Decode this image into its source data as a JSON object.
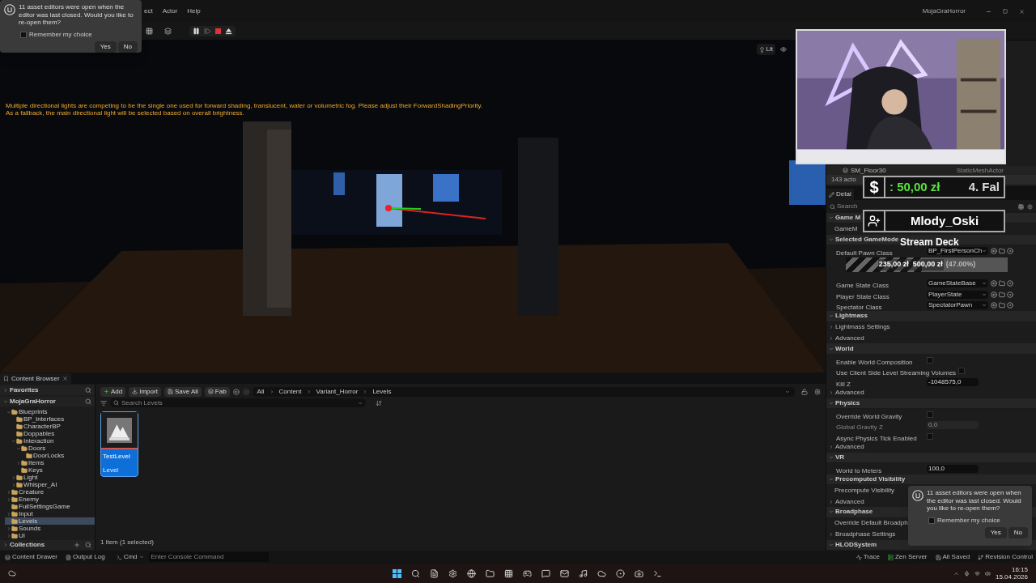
{
  "title_bar": {
    "menu": [
      "ect",
      "Actor",
      "Help"
    ],
    "project": "MojaGraHorror"
  },
  "viewport": {
    "warnings": [
      "Multiple directional lights are competing to be the single one used for forward shading, translucent, water or volumetric fog. Please adjust their ForwardShadingPriority.",
      "As a fallback, the main directional light will be selected based on overall brightness."
    ],
    "view_mode": "Lit"
  },
  "toasts": [
    {
      "message": "11 asset editors were open when the editor was last closed. Would you like to re-open them?",
      "remember": {
        "label": "Remember my choice",
        "checked": false
      },
      "buttons": [
        "Yes",
        "No"
      ]
    },
    {
      "message": "11 asset editors were open when the editor was last closed. Would you like to re-open them?",
      "remember": {
        "label": "Remember my choice",
        "checked": false
      },
      "buttons": [
        "Yes",
        "No"
      ]
    }
  ],
  "stream_overlay": {
    "currency_symbol": "$",
    "money": ": 50,00 zł",
    "wave": "4. Fal",
    "user": "Mlody_Oski",
    "goal_title": "Stream Deck",
    "goal_amounts": "235,00 zł  500,00 zł",
    "goal_percent": "(47.00%)",
    "level": 0.47
  },
  "outliner": {
    "selected_actor": "SM_Floor30",
    "selected_type": "StaticMeshActor",
    "count": "143 acto"
  },
  "details": {
    "tab": "Detai",
    "search_placeholder": "Search",
    "rows": [
      {
        "kind": "section",
        "label": "Game M",
        "expanded": true
      },
      {
        "kind": "property",
        "label": "GameM"
      },
      {
        "kind": "section",
        "label": "Selected GameMode",
        "expanded": true
      },
      {
        "kind": "dropdown",
        "label": "Default Pawn Class",
        "value": "BP_FirstPersonCh"
      },
      {
        "kind": "covered"
      },
      {
        "kind": "covered"
      },
      {
        "kind": "dropdown",
        "label": "Game State Class",
        "value": "GameStateBase"
      },
      {
        "kind": "dropdown",
        "label": "Player State Class",
        "value": "PlayerState"
      },
      {
        "kind": "dropdown",
        "label": "Spectator Class",
        "value": "SpectatorPawn"
      },
      {
        "kind": "section",
        "label": "Lightmass",
        "expanded": true
      },
      {
        "kind": "group",
        "label": "Lightmass Settings",
        "expanded": false
      },
      {
        "kind": "group",
        "label": "Advanced",
        "expanded": false
      },
      {
        "kind": "section",
        "label": "World",
        "expanded": true
      },
      {
        "kind": "checkbox",
        "label": "Enable World Composition",
        "checked": false
      },
      {
        "kind": "checkbox",
        "label": "Use Client Side Level Streaming Volumes",
        "checked": false
      },
      {
        "kind": "number",
        "label": "Kill Z",
        "value": "-1048575,0",
        "disabled": false
      },
      {
        "kind": "group",
        "label": "Advanced",
        "expanded": false
      },
      {
        "kind": "section",
        "label": "Physics",
        "expanded": true
      },
      {
        "kind": "checkbox",
        "label": "Override World Gravity",
        "checked": false
      },
      {
        "kind": "number",
        "label": "Global Gravity Z",
        "value": "0,0",
        "disabled": true
      },
      {
        "kind": "checkbox",
        "label": "Async Physics Tick Enabled",
        "checked": false
      },
      {
        "kind": "group",
        "label": "Advanced",
        "expanded": false
      },
      {
        "kind": "section",
        "label": "VR",
        "expanded": true
      },
      {
        "kind": "number",
        "label": "World to Meters",
        "value": "100,0",
        "disabled": false
      },
      {
        "kind": "section",
        "label": "Precomputed Visibility",
        "expanded": true
      },
      {
        "kind": "property",
        "label": "Precompute Visibility"
      },
      {
        "kind": "group",
        "label": "Advanced",
        "expanded": false
      },
      {
        "kind": "section",
        "label": "Broadphase",
        "expanded": true
      },
      {
        "kind": "property",
        "label": "Override Default Broadph"
      },
      {
        "kind": "group",
        "label": "Broadphase Settings",
        "expanded": false
      },
      {
        "kind": "section",
        "label": "HLODSystem",
        "expanded": true
      }
    ]
  },
  "content_browser": {
    "tab": "Content Browser",
    "favorites": "Favorites",
    "project": "MojaGraHorror",
    "collections": "Collections",
    "tree": [
      {
        "label": "Blueprints",
        "expandable": true,
        "expanded": true,
        "selected": false,
        "children": [
          {
            "label": "BP_Interfaces",
            "expandable": false,
            "expanded": false,
            "selected": false
          },
          {
            "label": "CharacterBP",
            "expandable": false,
            "expanded": false,
            "selected": false
          },
          {
            "label": "Doppables",
            "expandable": false,
            "expanded": false,
            "selected": false
          },
          {
            "label": "Interaction",
            "expandable": true,
            "expanded": true,
            "selected": false,
            "children": [
              {
                "label": "Doors",
                "expandable": true,
                "expanded": true,
                "selected": false,
                "children": [
                  {
                    "label": "DoorLocks",
                    "expandable": false,
                    "expanded": false,
                    "selected": false
                  }
                ]
              },
              {
                "label": "Items",
                "expandable": true,
                "expanded": false,
                "selected": false
              },
              {
                "label": "Keys",
                "expandable": false,
                "expanded": false,
                "selected": false
              }
            ]
          },
          {
            "label": "Light",
            "expandable": true,
            "expanded": false,
            "selected": false
          },
          {
            "label": "Whisper_AI",
            "expandable": true,
            "expanded": false,
            "selected": false
          }
        ]
      },
      {
        "label": "Creature",
        "expandable": true,
        "expanded": false,
        "selected": false
      },
      {
        "label": "Enemy",
        "expandable": true,
        "expanded": false,
        "selected": false
      },
      {
        "label": "FullSettingsGame",
        "expandable": false,
        "expanded": false,
        "selected": false
      },
      {
        "label": "Input",
        "expandable": true,
        "expanded": false,
        "selected": false
      },
      {
        "label": "Levels",
        "expandable": false,
        "expanded": false,
        "selected": true
      },
      {
        "label": "Sounds",
        "expandable": true,
        "expanded": false,
        "selected": false
      },
      {
        "label": "UI",
        "expandable": true,
        "expanded": false,
        "selected": false
      }
    ],
    "toolbar": [
      "Add",
      "Import",
      "Save All",
      "Fab"
    ],
    "breadcrumb": [
      "All",
      "Content",
      "Variant_Horror",
      "Levels"
    ],
    "search_placeholder": "Search Levels",
    "assets": [
      {
        "name": "TestLevel",
        "type": "Level",
        "selected": true
      }
    ],
    "footer": "1 item (1 selected)"
  },
  "status_bar": {
    "left": [
      "Content Drawer",
      "Output Log"
    ],
    "cmd": "Cmd",
    "console_placeholder": "Enter Console Command",
    "right": [
      "Trace",
      "Zen Server",
      "All Saved",
      "Revision Control"
    ]
  },
  "taskbar": {
    "time": "16:15",
    "date": "15.04.2026"
  }
}
